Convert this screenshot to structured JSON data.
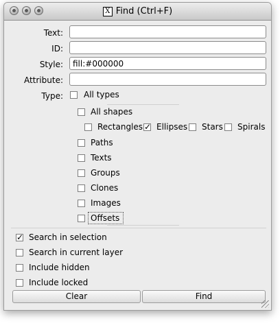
{
  "window": {
    "title": "Find (Ctrl+F)",
    "app_icon": "x11-icon"
  },
  "fields": {
    "text": {
      "label": "Text:",
      "value": ""
    },
    "id": {
      "label": "ID:",
      "value": ""
    },
    "style": {
      "label": "Style:",
      "value": "fill:#000000"
    },
    "attribute": {
      "label": "Attribute:",
      "value": ""
    }
  },
  "type": {
    "label": "Type:",
    "all_types": {
      "label": "All types",
      "checked": false
    },
    "all_shapes": {
      "label": "All shapes",
      "checked": false
    },
    "shapes": [
      {
        "label": "Rectangles",
        "checked": false
      },
      {
        "label": "Ellipses",
        "checked": true
      },
      {
        "label": "Stars",
        "checked": false
      },
      {
        "label": "Spirals",
        "checked": false
      }
    ],
    "others": [
      {
        "label": "Paths",
        "checked": false
      },
      {
        "label": "Texts",
        "checked": false
      },
      {
        "label": "Groups",
        "checked": false
      },
      {
        "label": "Clones",
        "checked": false
      },
      {
        "label": "Images",
        "checked": false
      },
      {
        "label": "Offsets",
        "checked": false
      }
    ]
  },
  "options": [
    {
      "label": "Search in selection",
      "checked": true
    },
    {
      "label": "Search in current layer",
      "checked": false
    },
    {
      "label": "Include hidden",
      "checked": false
    },
    {
      "label": "Include locked",
      "checked": false
    }
  ],
  "buttons": {
    "clear": "Clear",
    "find": "Find"
  }
}
